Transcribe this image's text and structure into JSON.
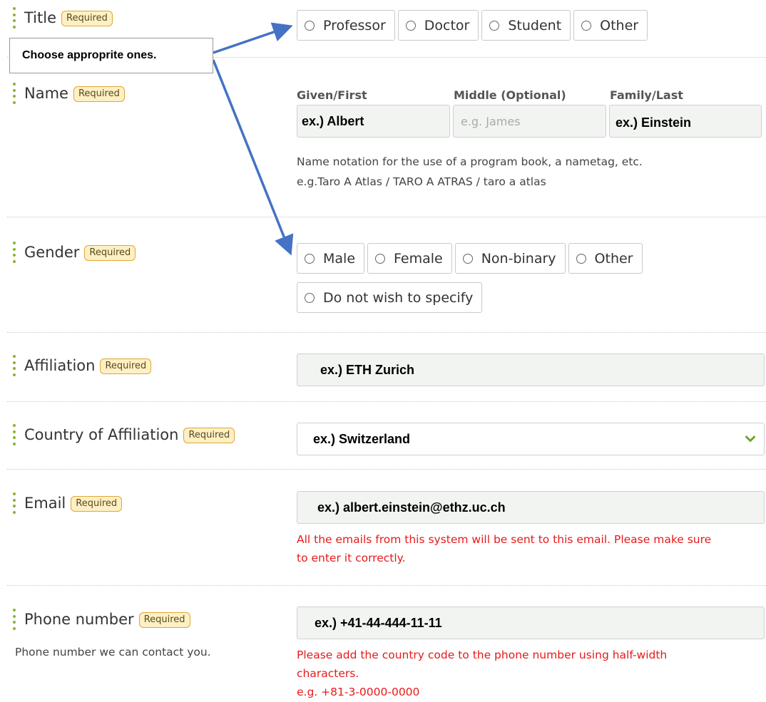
{
  "title_field": {
    "label": "Title",
    "required": "Required",
    "options": [
      "Professor",
      "Doctor",
      "Student",
      "Other"
    ]
  },
  "callout": {
    "text": "Choose  approprite ones."
  },
  "name_field": {
    "label": "Name",
    "required": "Required",
    "given_header": "Given/First",
    "middle_header": "Middle (Optional)",
    "family_header": "Family/Last",
    "given_value": "ex.) Albert",
    "middle_placeholder": "e.g. James",
    "family_value": "ex.) Einstein",
    "hint_line1": "Name notation for the use of a program book, a nametag, etc.",
    "hint_line2": "e.g.Taro A Atlas / TARO A ATRAS / taro a atlas"
  },
  "gender_field": {
    "label": "Gender",
    "required": "Required",
    "options": [
      "Male",
      "Female",
      "Non-binary",
      "Other",
      "Do not wish to specify"
    ]
  },
  "affiliation_field": {
    "label": "Affiliation",
    "required": "Required",
    "value": "ex.) ETH Zurich"
  },
  "country_field": {
    "label": "Country of Affiliation",
    "required": "Required",
    "value": "ex.) Switzerland",
    "icon": "chevron-down-icon"
  },
  "email_field": {
    "label": "Email",
    "required": "Required",
    "value": "ex.) albert.einstein@ethz.uc.ch",
    "error_line1": "All the emails from this system will be sent to this email. Please make sure",
    "error_line2": "to enter it correctly."
  },
  "phone_field": {
    "label": "Phone number",
    "required": "Required",
    "value": "ex.) +41-44-444-11-11",
    "sublabel": "Phone number we can contact you.",
    "error_line1": "Please add the country code to the phone number using half-width",
    "error_line2": "characters.",
    "error_line3": "e.g. +81-3-0000-0000"
  },
  "colors": {
    "accent_dots": "#8bb332",
    "required_bg": "#fdf0c4",
    "required_border": "#e0a634",
    "error": "#e8191a",
    "arrow": "#4472c4"
  }
}
